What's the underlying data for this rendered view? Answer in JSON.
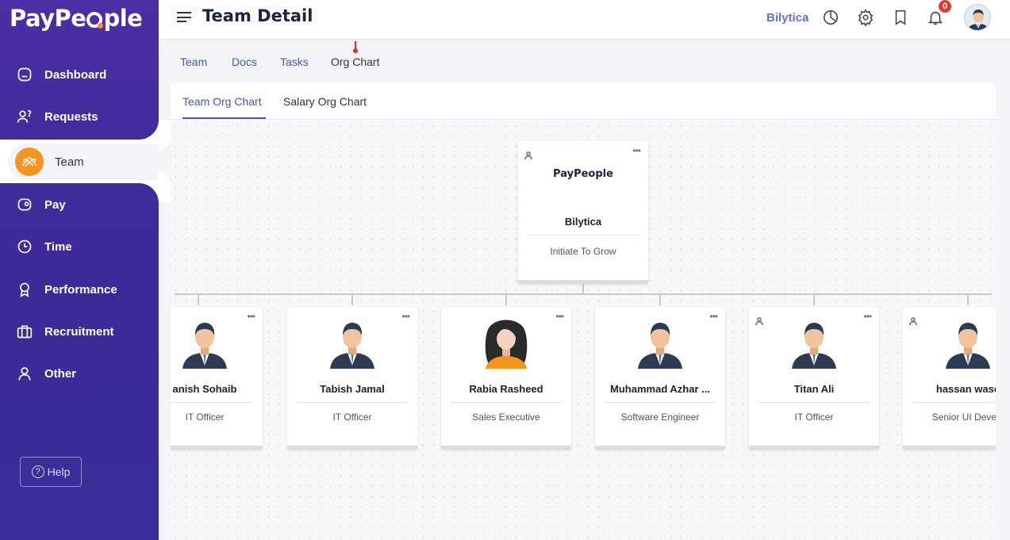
{
  "app": {
    "logo_text": "PayPeople"
  },
  "sidebar": {
    "items": [
      {
        "label": "Dashboard",
        "icon": "home-icon"
      },
      {
        "label": "Requests",
        "icon": "user-question-icon"
      },
      {
        "label": "Team",
        "icon": "team-icon",
        "active": true
      },
      {
        "label": "Pay",
        "icon": "wallet-icon"
      },
      {
        "label": "Time",
        "icon": "clock-icon"
      },
      {
        "label": "Performance",
        "icon": "award-icon"
      },
      {
        "label": "Recruitment",
        "icon": "briefcase-icon"
      },
      {
        "label": "Other",
        "icon": "user-icon"
      }
    ],
    "help_label": "Help"
  },
  "header": {
    "title": "Team Detail",
    "company": "Bilytica",
    "notification_count": "0"
  },
  "tabs": [
    {
      "label": "Team"
    },
    {
      "label": "Docs"
    },
    {
      "label": "Tasks"
    },
    {
      "label": "Org Chart",
      "active": true
    }
  ],
  "subtabs": [
    {
      "label": "Team Org Chart",
      "active": true
    },
    {
      "label": "Salary Org Chart"
    }
  ],
  "org": {
    "root": {
      "logo_text": "PayPeople",
      "name": "Bilytica",
      "role": "Initiate To Grow"
    },
    "children": [
      {
        "name": "Danish Sohaib",
        "display_name": "anish Sohaib",
        "role": "IT Officer",
        "avatar": "male"
      },
      {
        "name": "Tabish Jamal",
        "display_name": "Tabish Jamal",
        "role": "IT Officer",
        "avatar": "male"
      },
      {
        "name": "Rabia Rasheed",
        "display_name": "Rabia Rasheed",
        "role": "Sales Executive",
        "avatar": "female"
      },
      {
        "name": "Muhammad Azhar ...",
        "display_name": "Muhammad Azhar ...",
        "role": "Software Engineer",
        "avatar": "male"
      },
      {
        "name": "Titan Ali",
        "display_name": "Titan Ali",
        "role": "IT Officer",
        "avatar": "male"
      },
      {
        "name": "hassan wase",
        "display_name": "hassan wase",
        "role": "Senior UI Develo",
        "avatar": "male"
      }
    ]
  },
  "colors": {
    "sidebar": "#3f2c9c",
    "accent": "#4a55b5",
    "orange": "#f7941d",
    "badge": "#e53935"
  }
}
